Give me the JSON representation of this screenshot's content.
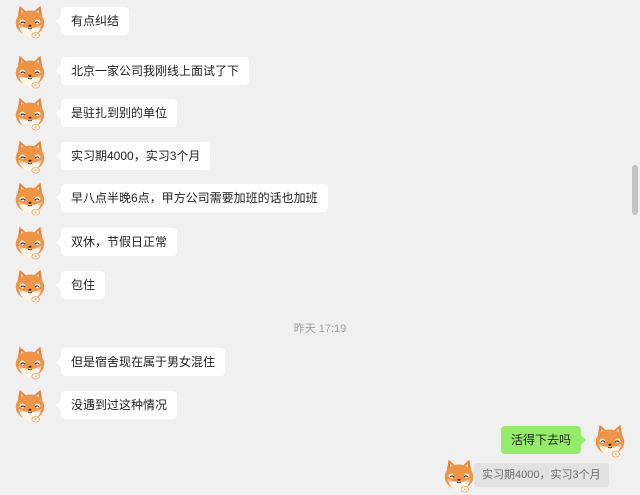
{
  "messages": [
    {
      "side": "left",
      "text": "有点纠结"
    },
    {
      "side": "left",
      "text": "北京一家公司我刚线上面试了下"
    },
    {
      "side": "left",
      "text": "是驻扎到别的单位"
    },
    {
      "side": "left",
      "text": "实习期4000，实习3个月"
    },
    {
      "side": "left",
      "text": "早八点半晚6点，甲方公司需要加班的话也加班"
    },
    {
      "side": "left",
      "text": "双休，节假日正常"
    },
    {
      "side": "left",
      "text": "包住"
    }
  ],
  "timestamp": "昨天 17:19",
  "messages_after": [
    {
      "side": "left",
      "text": "但是宿舍现在属于男女混住"
    },
    {
      "side": "left",
      "text": "没遇到过这种情况"
    }
  ],
  "my_message": {
    "side": "right",
    "text": "活得下去吗"
  },
  "quoted": {
    "text": "实习期4000，实习3个月"
  },
  "colors": {
    "background": "#f0f0f0",
    "bubble_left": "#ffffff",
    "bubble_right": "#95ec69",
    "quote": "#e2e2e2"
  },
  "avatar_icon": "shiba-dog-icon"
}
